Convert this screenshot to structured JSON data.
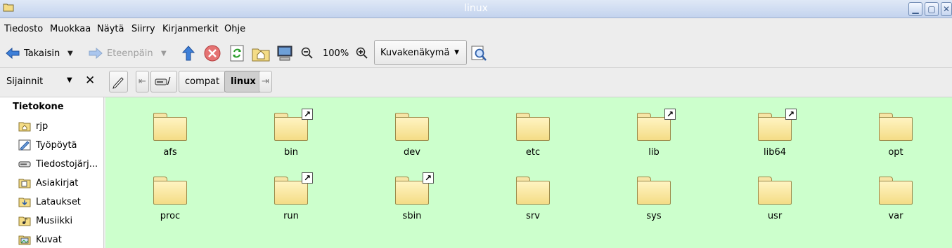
{
  "window": {
    "title": "linux"
  },
  "menubar": [
    "Tiedosto",
    "Muokkaa",
    "Näytä",
    "Siirry",
    "Kirjanmerkit",
    "Ohje"
  ],
  "toolbar": {
    "back_label": "Takaisin",
    "forward_label": "Eteenpäin",
    "zoom_level": "100%",
    "view_mode": "Kuvakenäkymä"
  },
  "locationbar": {
    "sidebar_title": "Sijainnit",
    "root_label": "/",
    "path": [
      "compat",
      "linux"
    ]
  },
  "sidebar": {
    "section": "Tietokone",
    "items": [
      {
        "label": "rjp",
        "icon": "home-folder-icon"
      },
      {
        "label": "Työpöytä",
        "icon": "desktop-icon"
      },
      {
        "label": "Tiedostojärj...",
        "icon": "filesystem-drive-icon"
      },
      {
        "label": "Asiakirjat",
        "icon": "documents-folder-icon"
      },
      {
        "label": "Lataukset",
        "icon": "downloads-folder-icon"
      },
      {
        "label": "Musiikki",
        "icon": "music-folder-icon"
      },
      {
        "label": "Kuvat",
        "icon": "pictures-folder-icon"
      }
    ]
  },
  "files": [
    {
      "name": "afs",
      "symlink": false
    },
    {
      "name": "bin",
      "symlink": true
    },
    {
      "name": "dev",
      "symlink": false
    },
    {
      "name": "etc",
      "symlink": false
    },
    {
      "name": "lib",
      "symlink": true
    },
    {
      "name": "lib64",
      "symlink": true
    },
    {
      "name": "opt",
      "symlink": false
    },
    {
      "name": "proc",
      "symlink": false
    },
    {
      "name": "run",
      "symlink": true
    },
    {
      "name": "sbin",
      "symlink": true
    },
    {
      "name": "srv",
      "symlink": false
    },
    {
      "name": "sys",
      "symlink": false
    },
    {
      "name": "usr",
      "symlink": false
    },
    {
      "name": "var",
      "symlink": false
    }
  ],
  "colors": {
    "view_background": "#ccffcc",
    "folder": "#f4dc86"
  }
}
